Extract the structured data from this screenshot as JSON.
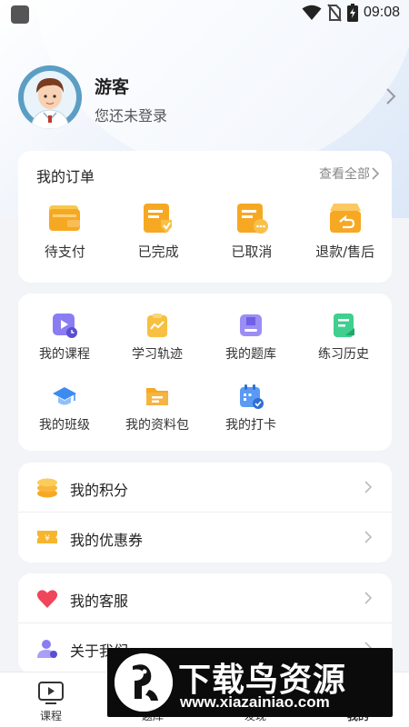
{
  "status_bar": {
    "time": "09:08"
  },
  "profile": {
    "name": "游客",
    "subtitle": "您还未登录"
  },
  "orders": {
    "title": "我的订单",
    "view_all": "查看全部",
    "items": [
      {
        "label": "待支付",
        "icon": "wallet-icon"
      },
      {
        "label": "已完成",
        "icon": "order-completed-icon"
      },
      {
        "label": "已取消",
        "icon": "order-cancelled-icon"
      },
      {
        "label": "退款/售后",
        "icon": "refund-icon"
      }
    ]
  },
  "tools": [
    {
      "label": "我的课程",
      "icon": "course-video-icon"
    },
    {
      "label": "学习轨迹",
      "icon": "learning-track-icon"
    },
    {
      "label": "我的题库",
      "icon": "question-bank-icon"
    },
    {
      "label": "练习历史",
      "icon": "practice-history-icon"
    },
    {
      "label": "我的班级",
      "icon": "graduation-cap-icon"
    },
    {
      "label": "我的资料包",
      "icon": "folder-icon"
    },
    {
      "label": "我的打卡",
      "icon": "calendar-check-icon"
    }
  ],
  "list1": [
    {
      "label": "我的积分",
      "icon": "coins-icon"
    },
    {
      "label": "我的优惠券",
      "icon": "coupon-icon"
    }
  ],
  "list2": [
    {
      "label": "我的客服",
      "icon": "heart-icon"
    },
    {
      "label": "关于我们",
      "icon": "about-user-icon"
    }
  ],
  "tabbar": [
    {
      "label": "课程",
      "icon": "play-screen-icon"
    },
    {
      "label": "题库",
      "icon": "book-icon"
    },
    {
      "label": "发现",
      "icon": "compass-icon"
    },
    {
      "label": "我的",
      "icon": "user-icon"
    }
  ],
  "watermark": {
    "title": "下载鸟资源",
    "url": "www.xiazainiao.com"
  },
  "colors": {
    "accent_orange": "#f7a823",
    "accent_purple": "#8a7df2",
    "accent_green": "#3fcf8e",
    "accent_blue": "#3d8bf2",
    "heart_red": "#f0455a"
  }
}
